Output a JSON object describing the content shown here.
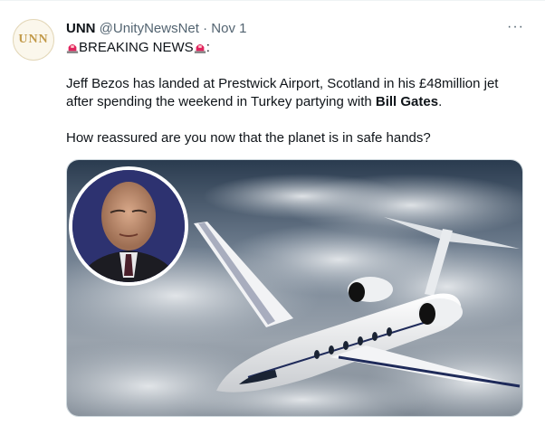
{
  "tweet": {
    "display_name": "UNN",
    "handle": "@UnityNewsNet",
    "separator": "·",
    "date": "Nov 1",
    "more_label": "···",
    "avatar_text": "UNN",
    "headline": "BREAKING NEWS",
    "headline_suffix": ":",
    "para1_before": "Jeff Bezos has landed at Prestwick Airport, Scotland in his £48million jet after spending the weekend in Turkey partying with ",
    "para1_bold": "Bill Gates",
    "para1_after": ".",
    "para2": "How reassured are you now that the planet is in safe hands?"
  },
  "icons": {
    "siren": "police-siren-icon",
    "more": "more-options-icon"
  },
  "colors": {
    "secondary_text": "#536471",
    "siren_red": "#e0245e",
    "avatar_gold": "#c29a4a"
  }
}
